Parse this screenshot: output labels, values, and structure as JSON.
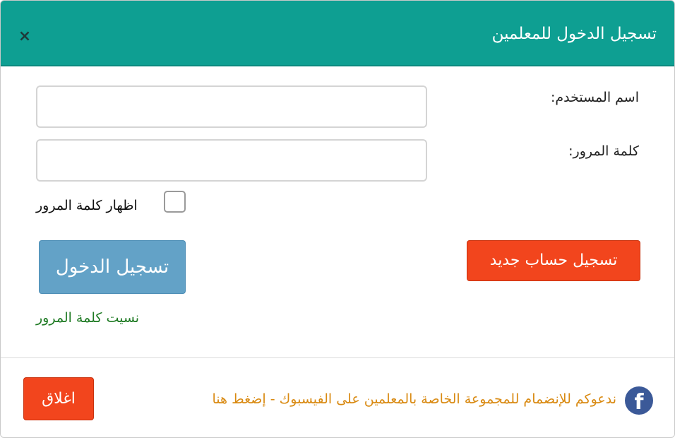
{
  "header": {
    "title": "تسجيل الدخول للمعلمين",
    "close_icon": "×"
  },
  "form": {
    "username_label": "اسم المستخدم:",
    "username_value": "",
    "password_label": "كلمة المرور:",
    "password_value": "",
    "show_password_label": "اظهار كلمة المرور",
    "show_password_checked": false,
    "login_button": "تسجيل الدخول",
    "register_button": "تسجيل حساب جديد",
    "forgot_link": "نسيت كلمة المرور"
  },
  "footer": {
    "facebook_text": "ندعوكم للإنضمام للمجموعة الخاصة بالمعلمين على الفيسبوك - إضغط هنا",
    "facebook_icon": "facebook-icon",
    "close_button": "اغلاق"
  },
  "colors": {
    "header_bg": "#0e9f92",
    "login_button_bg": "#63a2c7",
    "register_button_bg": "#f2451d",
    "close_button_bg": "#f2451d",
    "forgot_link": "#1e7a23",
    "facebook_text": "#d98a12",
    "facebook_icon_bg": "#3b5998"
  }
}
